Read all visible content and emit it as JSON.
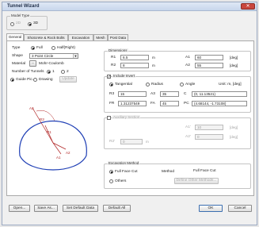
{
  "window": {
    "title": "Tunnel Wizard",
    "close_glyph": "✕"
  },
  "model_type": {
    "label": "Model Type",
    "options": [
      "2D",
      "3D"
    ],
    "selected": "3D"
  },
  "tabs": [
    "General",
    "Shotcrete & Rock Bolts",
    "Excavation",
    "Mesh",
    "Post Data"
  ],
  "active_tab": "General",
  "general": {
    "type_label": "Type",
    "type_full": "Full",
    "type_half": "Half(Right)",
    "shape_label": "Shape",
    "shape_value": "3 Point Circle",
    "material_label": "Material",
    "material_button": "...",
    "material_value": "Mohr-Coulomb",
    "tunnels_label": "Number of Tunnels",
    "tunnels_1": "1",
    "tunnels_2": "2",
    "guide_label": "Guide Pic.",
    "drawing_label": "Drawing",
    "update_button": "Update"
  },
  "preview": {
    "labels": [
      "A3",
      "R3",
      "R1",
      "A1",
      "A2"
    ],
    "stroke_color": "#1f3fb5"
  },
  "dimensions": {
    "label": "Dimensions",
    "r1_label": "R1",
    "r1_value": "6.5",
    "r1_unit": "m",
    "a1_label": "A1",
    "a1_value": "60",
    "a1_unit": "[deg]",
    "r2_label": "R2",
    "r2_value": "8",
    "r2_unit": "m",
    "a2_label": "A2",
    "a2_value": "55",
    "a2_unit": "[deg]"
  },
  "invert": {
    "checkbox_label": "Include Invert",
    "checked_glyph": "✓",
    "tangential": "Tangential",
    "radius": "Radius",
    "angle": "Angle",
    "unit_note": "Unit: m, [deg]",
    "r3_label": "R3",
    "r3_value": "15",
    "a3_label": "A3",
    "a3_value": "35",
    "c_label": "C",
    "c_value": "(0, 11.13521)",
    "fr_label": "FR",
    "fr_value": "1.31237549",
    "fa_label": "FA",
    "fa_value": "45",
    "pc_label": "PC",
    "pc_value": "(4.68144, -1.73108)"
  },
  "auxiliary": {
    "checkbox_label": "Auxiliary Section",
    "r2_label": "R2'",
    "r2_value": "0",
    "r2_unit": "m",
    "a1_label": "A1'",
    "a1_value": "10",
    "a1_unit": "[deg]",
    "a2_label": "A2'",
    "a2_value": "0",
    "a2_unit": "[deg]"
  },
  "excavation": {
    "label": "Excavation Method",
    "full_face": "Full Face Cut",
    "others": "Others",
    "method_label": "Method",
    "method_value": "Full Face Cut",
    "define_button": "Define Other Methods..."
  },
  "footer": {
    "open": "Open...",
    "save_as": "Save As...",
    "set_default": "Set Default Data",
    "default_all": "Default All",
    "ok": "OK",
    "cancel": "Cancel"
  }
}
